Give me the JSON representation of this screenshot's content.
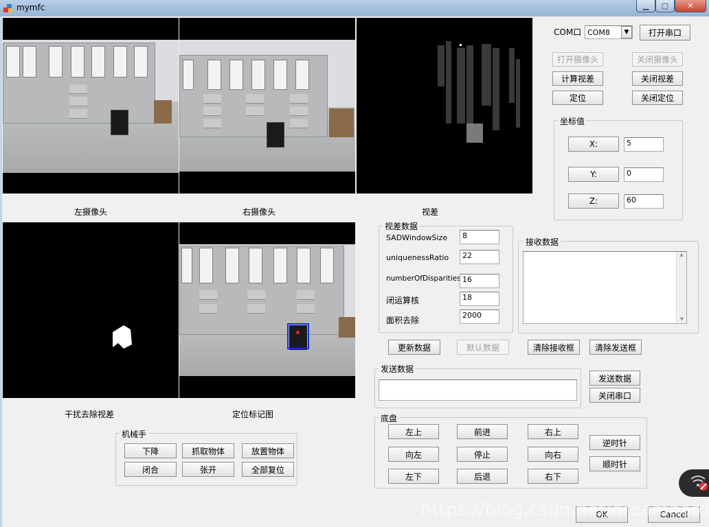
{
  "window": {
    "title": "mymfc"
  },
  "panels": {
    "left_camera": "左摄像头",
    "right_camera": "右摄像头",
    "disparity": "视差",
    "filtered_disparity": "干扰去除视差",
    "marked_map": "定位标记图"
  },
  "serial": {
    "com_label": "COM口",
    "com_value": "COM8",
    "open_port": "打开串口"
  },
  "controls": {
    "open_camera": "打开摄像头",
    "close_camera": "关闭摄像头",
    "compute_disparity": "计算视差",
    "close_disparity": "关闭视差",
    "locate": "定位",
    "close_locate": "关闭定位"
  },
  "coords": {
    "group_label": "坐标值",
    "x_label": "X:",
    "y_label": "Y:",
    "z_label": "Z:",
    "x_value": "5",
    "y_value": "0",
    "z_value": "60"
  },
  "disparity_data": {
    "group_label": "视差数据",
    "params": [
      {
        "label": "SADWindowSize",
        "value": "8"
      },
      {
        "label": "uniquenessRatio",
        "value": "22"
      },
      {
        "label": "numberOfDisparities",
        "value": "16"
      },
      {
        "label": "闭运算核",
        "value": "18"
      },
      {
        "label": "面积去除",
        "value": "2000"
      }
    ]
  },
  "receive": {
    "group_label": "接收数据",
    "text": ""
  },
  "data_buttons": {
    "update": "更新数据",
    "default": "默认数据",
    "clear_receive": "清除接收框",
    "clear_send": "清除发送框"
  },
  "send": {
    "group_label": "发送数据",
    "text": "",
    "send_button": "发送数据",
    "close_port": "关闭串口"
  },
  "chassis": {
    "group_label": "底盘",
    "up_left": "左上",
    "forward": "前进",
    "up_right": "右上",
    "left": "向左",
    "stop": "停止",
    "right": "向右",
    "down_left": "左下",
    "backward": "后退",
    "down_right": "右下",
    "ccw": "逆时针",
    "cw": "顺时针"
  },
  "arm": {
    "group_label": "机械手",
    "lower": "下降",
    "grab": "抓取物体",
    "place": "放置物体",
    "close": "闭合",
    "open": "张开",
    "reset": "全部复位"
  },
  "dialog": {
    "ok": "OK",
    "cancel": "Cancel"
  },
  "watermark": "https://blog.csdn.net/dreamhardng",
  "colors": {
    "titlebar": "#a6c0dc",
    "panel_bg": "#000000",
    "client_bg": "#f0f0f0",
    "bbox": "#1a2fd6"
  }
}
